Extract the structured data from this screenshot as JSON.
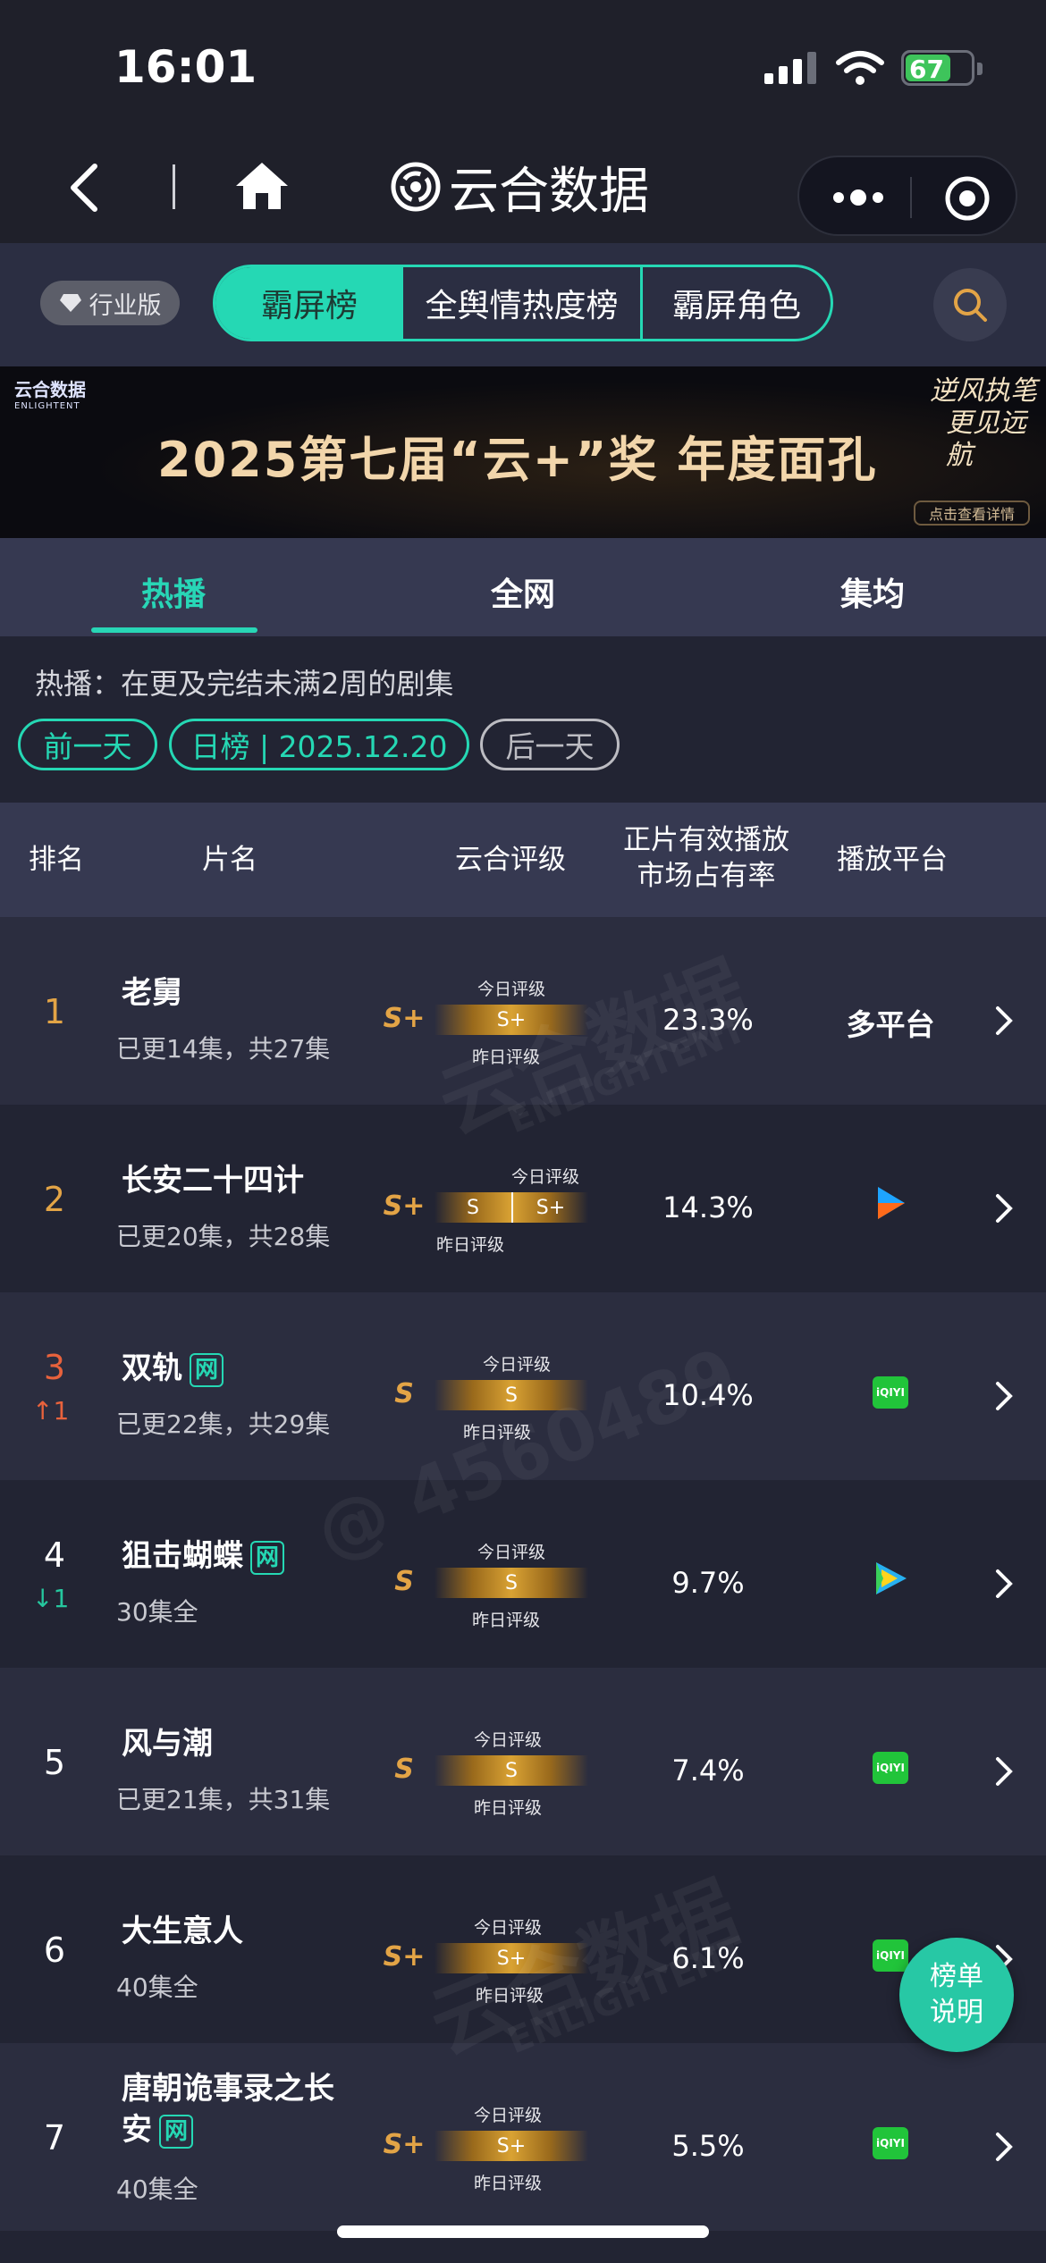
{
  "status_bar": {
    "time": "16:01",
    "battery": "67"
  },
  "nav": {
    "title": "云合数据"
  },
  "filter": {
    "industry_badge": "行业版",
    "tabs": [
      "霸屏榜",
      "全舆情热度榜",
      "霸屏角色"
    ]
  },
  "banner": {
    "brand": "云合数据",
    "brand_en": "ENLIGHTENT",
    "headline": "2025第七届“云+”奖  年度面孔",
    "calligraphy": [
      "逆风执笔",
      "更见远航"
    ],
    "detail_button": "点击查看详情"
  },
  "sub_tabs": [
    "热播",
    "全网",
    "集均"
  ],
  "info": {
    "description": "热播：在更及完结未满2周的剧集",
    "prev_day": "前一天",
    "date_label": "日榜 | 2025.12.20",
    "next_day": "后一天"
  },
  "table_header": {
    "rank": "排名",
    "name": "片名",
    "grade": "云合评级",
    "share_line1": "正片有效播放",
    "share_line2": "市场占有率",
    "platform": "播放平台"
  },
  "labels": {
    "today": "今日评级",
    "yesterday": "昨日评级"
  },
  "rows": [
    {
      "rank": "1",
      "change": "",
      "title": "老舅",
      "tag": "",
      "episodes": "已更14集，共27集",
      "grade": "S+",
      "today_grade": "S+",
      "yesterday_grade": "S+",
      "share": "23.3%",
      "platform": "多平台"
    },
    {
      "rank": "2",
      "change": "",
      "title": "长安二十四计",
      "tag": "",
      "episodes": "已更20集，共28集",
      "grade": "S+",
      "today_grade": "S+",
      "yesterday_grade": "S",
      "share": "14.3%",
      "platform": "youku-icon"
    },
    {
      "rank": "3",
      "change": "↑1",
      "title": "双轨",
      "tag": "网",
      "episodes": "已更22集，共29集",
      "grade": "S",
      "today_grade": "S",
      "yesterday_grade": "S",
      "share": "10.4%",
      "platform": "iqiyi-icon"
    },
    {
      "rank": "4",
      "change": "↓1",
      "title": "狙击蝴蝶",
      "tag": "网",
      "episodes": "30集全",
      "grade": "S",
      "today_grade": "S",
      "yesterday_grade": "S",
      "share": "9.7%",
      "platform": "tencent-video-icon"
    },
    {
      "rank": "5",
      "change": "",
      "title": "风与潮",
      "tag": "",
      "episodes": "已更21集，共31集",
      "grade": "S",
      "today_grade": "S",
      "yesterday_grade": "S",
      "share": "7.4%",
      "platform": "iqiyi-icon"
    },
    {
      "rank": "6",
      "change": "",
      "title": "大生意人",
      "tag": "",
      "episodes": "40集全",
      "grade": "S+",
      "today_grade": "S+",
      "yesterday_grade": "S+",
      "share": "6.1%",
      "platform": "iqiyi-icon"
    },
    {
      "rank": "7",
      "change": "",
      "title_line1": "唐朝诡事录之长",
      "title_line2": "安",
      "tag": "网",
      "episodes": "40集全",
      "grade": "S+",
      "today_grade": "S+",
      "yesterday_grade": "S+",
      "share": "5.5%",
      "platform": "iqiyi-icon"
    }
  ],
  "iqiyi_text": "iQIYI",
  "float_button": [
    "榜单",
    "说明"
  ],
  "watermark": {
    "brand": "云合数据",
    "brand_en": "ENLIGHTENT",
    "handle": "@ 4560489"
  },
  "colors": {
    "accent": "#25d8b4",
    "gold": "#e3a446",
    "up": "#e8623c",
    "down": "#25c79e"
  }
}
